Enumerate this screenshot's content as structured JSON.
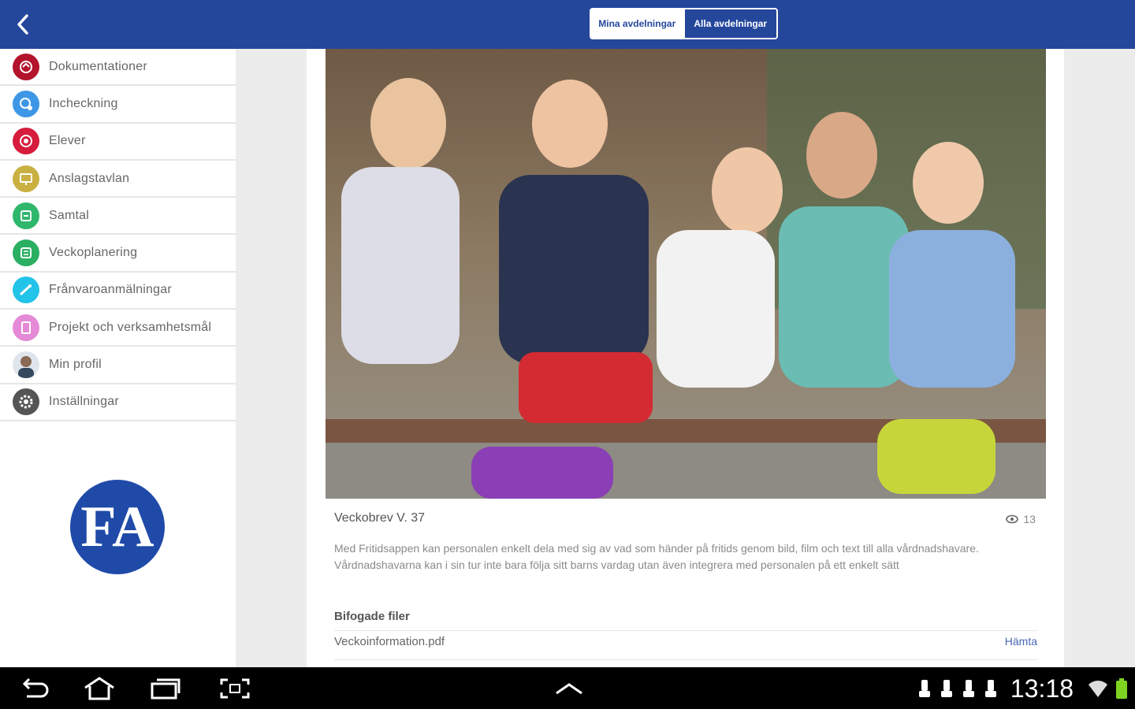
{
  "topbar": {
    "tabs": [
      {
        "label": "Mina avdelningar",
        "active": true
      },
      {
        "label": "Alla avdelningar",
        "active": false
      }
    ],
    "color": "#24479c"
  },
  "sidebar": {
    "items": [
      {
        "label": "Dokumentationer",
        "icon": "documentation-icon",
        "color": "#b3132b"
      },
      {
        "label": "Incheckning",
        "icon": "checkin-icon",
        "color": "#3e97e6"
      },
      {
        "label": "Elever",
        "icon": "students-icon",
        "color": "#d61b3c"
      },
      {
        "label": "Anslagstavlan",
        "icon": "bulletin-board-icon",
        "color": "#c9b041"
      },
      {
        "label": "Samtal",
        "icon": "conversation-icon",
        "color": "#2fb76c"
      },
      {
        "label": "Veckoplanering",
        "icon": "weekly-planning-icon",
        "color": "#2aaf63"
      },
      {
        "label": "Frånvaroanmälningar",
        "icon": "absence-report-icon",
        "color": "#22c3e8"
      },
      {
        "label": "Projekt och verksamhetsmål",
        "icon": "project-goals-icon",
        "color": "#e58ad7"
      },
      {
        "label": "Min profil",
        "icon": "profile-avatar-icon",
        "color": "#8d9fb5"
      },
      {
        "label": "Inställningar",
        "icon": "settings-gear-icon",
        "color": "#555555"
      }
    ],
    "logo_text": "FA"
  },
  "post": {
    "title": "Veckobrev V. 37",
    "views": "13",
    "body": "Med Fritidsappen kan personalen enkelt dela med sig av vad som händer på fritids genom bild, film och text till alla vårdnadshavare. Vårdnadshavarna kan i sin tur inte bara följa sitt barns vardag utan även integrera med personalen på ett enkelt sätt",
    "attachments_heading": "Bifogade filer",
    "attachments": [
      {
        "name": "Veckoinformation.pdf",
        "action": "Hämta"
      }
    ]
  },
  "statusbar": {
    "time": "13:18"
  }
}
